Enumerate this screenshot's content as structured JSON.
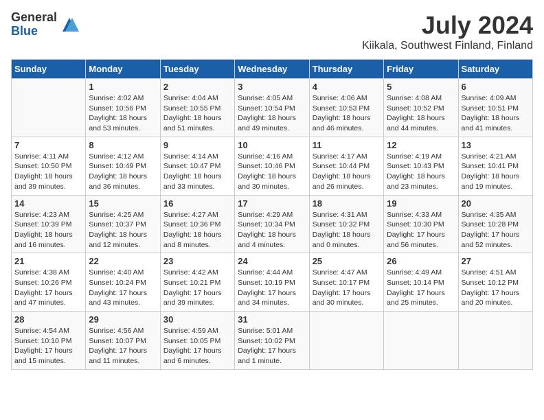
{
  "header": {
    "logo_general": "General",
    "logo_blue": "Blue",
    "title": "July 2024",
    "subtitle": "Kiikala, Southwest Finland, Finland"
  },
  "days_of_week": [
    "Sunday",
    "Monday",
    "Tuesday",
    "Wednesday",
    "Thursday",
    "Friday",
    "Saturday"
  ],
  "weeks": [
    [
      {
        "day": "",
        "info": ""
      },
      {
        "day": "1",
        "info": "Sunrise: 4:02 AM\nSunset: 10:56 PM\nDaylight: 18 hours\nand 53 minutes."
      },
      {
        "day": "2",
        "info": "Sunrise: 4:04 AM\nSunset: 10:55 PM\nDaylight: 18 hours\nand 51 minutes."
      },
      {
        "day": "3",
        "info": "Sunrise: 4:05 AM\nSunset: 10:54 PM\nDaylight: 18 hours\nand 49 minutes."
      },
      {
        "day": "4",
        "info": "Sunrise: 4:06 AM\nSunset: 10:53 PM\nDaylight: 18 hours\nand 46 minutes."
      },
      {
        "day": "5",
        "info": "Sunrise: 4:08 AM\nSunset: 10:52 PM\nDaylight: 18 hours\nand 44 minutes."
      },
      {
        "day": "6",
        "info": "Sunrise: 4:09 AM\nSunset: 10:51 PM\nDaylight: 18 hours\nand 41 minutes."
      }
    ],
    [
      {
        "day": "7",
        "info": "Sunrise: 4:11 AM\nSunset: 10:50 PM\nDaylight: 18 hours\nand 39 minutes."
      },
      {
        "day": "8",
        "info": "Sunrise: 4:12 AM\nSunset: 10:49 PM\nDaylight: 18 hours\nand 36 minutes."
      },
      {
        "day": "9",
        "info": "Sunrise: 4:14 AM\nSunset: 10:47 PM\nDaylight: 18 hours\nand 33 minutes."
      },
      {
        "day": "10",
        "info": "Sunrise: 4:16 AM\nSunset: 10:46 PM\nDaylight: 18 hours\nand 30 minutes."
      },
      {
        "day": "11",
        "info": "Sunrise: 4:17 AM\nSunset: 10:44 PM\nDaylight: 18 hours\nand 26 minutes."
      },
      {
        "day": "12",
        "info": "Sunrise: 4:19 AM\nSunset: 10:43 PM\nDaylight: 18 hours\nand 23 minutes."
      },
      {
        "day": "13",
        "info": "Sunrise: 4:21 AM\nSunset: 10:41 PM\nDaylight: 18 hours\nand 19 minutes."
      }
    ],
    [
      {
        "day": "14",
        "info": "Sunrise: 4:23 AM\nSunset: 10:39 PM\nDaylight: 18 hours\nand 16 minutes."
      },
      {
        "day": "15",
        "info": "Sunrise: 4:25 AM\nSunset: 10:37 PM\nDaylight: 18 hours\nand 12 minutes."
      },
      {
        "day": "16",
        "info": "Sunrise: 4:27 AM\nSunset: 10:36 PM\nDaylight: 18 hours\nand 8 minutes."
      },
      {
        "day": "17",
        "info": "Sunrise: 4:29 AM\nSunset: 10:34 PM\nDaylight: 18 hours\nand 4 minutes."
      },
      {
        "day": "18",
        "info": "Sunrise: 4:31 AM\nSunset: 10:32 PM\nDaylight: 18 hours\nand 0 minutes."
      },
      {
        "day": "19",
        "info": "Sunrise: 4:33 AM\nSunset: 10:30 PM\nDaylight: 17 hours\nand 56 minutes."
      },
      {
        "day": "20",
        "info": "Sunrise: 4:35 AM\nSunset: 10:28 PM\nDaylight: 17 hours\nand 52 minutes."
      }
    ],
    [
      {
        "day": "21",
        "info": "Sunrise: 4:38 AM\nSunset: 10:26 PM\nDaylight: 17 hours\nand 47 minutes."
      },
      {
        "day": "22",
        "info": "Sunrise: 4:40 AM\nSunset: 10:24 PM\nDaylight: 17 hours\nand 43 minutes."
      },
      {
        "day": "23",
        "info": "Sunrise: 4:42 AM\nSunset: 10:21 PM\nDaylight: 17 hours\nand 39 minutes."
      },
      {
        "day": "24",
        "info": "Sunrise: 4:44 AM\nSunset: 10:19 PM\nDaylight: 17 hours\nand 34 minutes."
      },
      {
        "day": "25",
        "info": "Sunrise: 4:47 AM\nSunset: 10:17 PM\nDaylight: 17 hours\nand 30 minutes."
      },
      {
        "day": "26",
        "info": "Sunrise: 4:49 AM\nSunset: 10:14 PM\nDaylight: 17 hours\nand 25 minutes."
      },
      {
        "day": "27",
        "info": "Sunrise: 4:51 AM\nSunset: 10:12 PM\nDaylight: 17 hours\nand 20 minutes."
      }
    ],
    [
      {
        "day": "28",
        "info": "Sunrise: 4:54 AM\nSunset: 10:10 PM\nDaylight: 17 hours\nand 15 minutes."
      },
      {
        "day": "29",
        "info": "Sunrise: 4:56 AM\nSunset: 10:07 PM\nDaylight: 17 hours\nand 11 minutes."
      },
      {
        "day": "30",
        "info": "Sunrise: 4:59 AM\nSunset: 10:05 PM\nDaylight: 17 hours\nand 6 minutes."
      },
      {
        "day": "31",
        "info": "Sunrise: 5:01 AM\nSunset: 10:02 PM\nDaylight: 17 hours\nand 1 minute."
      },
      {
        "day": "",
        "info": ""
      },
      {
        "day": "",
        "info": ""
      },
      {
        "day": "",
        "info": ""
      }
    ]
  ]
}
